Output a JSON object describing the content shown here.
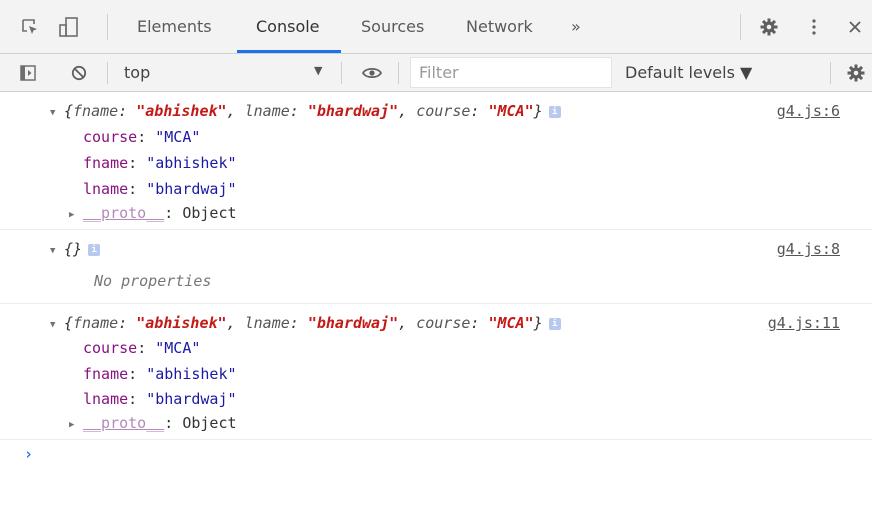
{
  "tabs": {
    "elements": "Elements",
    "console": "Console",
    "sources": "Sources",
    "network": "Network",
    "more": "»"
  },
  "toolbar": {
    "context": "top",
    "filter_placeholder": "Filter",
    "levels": "Default levels ▼"
  },
  "entries": [
    {
      "source": "g4.js:6",
      "summary": {
        "k1": "fname",
        "v1": "\"abhishek\"",
        "k2": "lname",
        "v2": "\"bhardwaj\"",
        "k3": "course",
        "v3": "\"MCA\""
      },
      "props": [
        {
          "key": "course",
          "value": "\"MCA\""
        },
        {
          "key": "fname",
          "value": "\"abhishek\""
        },
        {
          "key": "lname",
          "value": "\"bhardwaj\""
        }
      ],
      "proto_key": "__proto__",
      "proto_val": ": Object"
    },
    {
      "source": "g4.js:8",
      "summary_text": "{}",
      "no_props": "No properties"
    },
    {
      "source": "g4.js:11",
      "summary": {
        "k1": "fname",
        "v1": "\"abhishek\"",
        "k2": "lname",
        "v2": "\"bhardwaj\"",
        "k3": "course",
        "v3": "\"MCA\""
      },
      "props": [
        {
          "key": "course",
          "value": "\"MCA\""
        },
        {
          "key": "fname",
          "value": "\"abhishek\""
        },
        {
          "key": "lname",
          "value": "\"bhardwaj\""
        }
      ],
      "proto_key": "__proto__",
      "proto_val": ": Object"
    }
  ],
  "prompt": "›",
  "info_badge": "i",
  "icons": [
    "inspect-icon",
    "device-toggle-icon",
    "gear-icon",
    "kebab-menu-icon",
    "close-icon",
    "sidebar-toggle-icon",
    "clear-console-icon",
    "eye-icon",
    "settings-icon"
  ]
}
